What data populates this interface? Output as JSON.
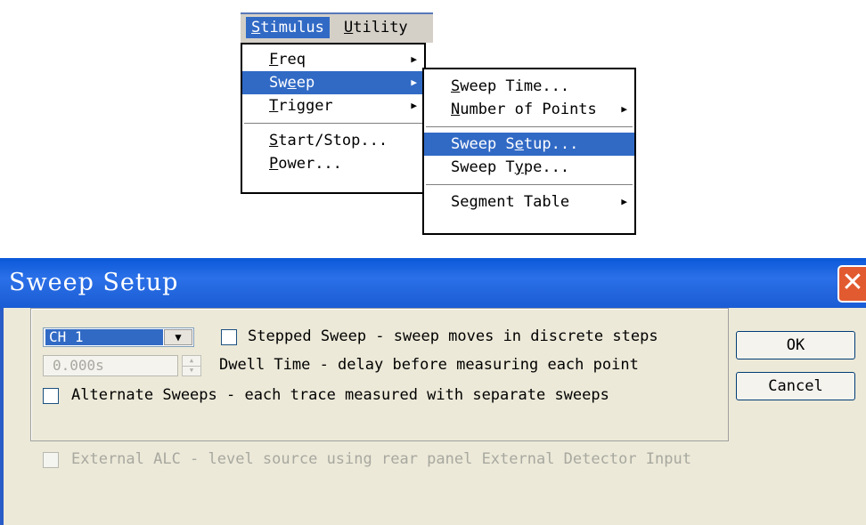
{
  "menubar": {
    "items": [
      {
        "prefix": "",
        "ul": "S",
        "rest": "timulus"
      },
      {
        "prefix": "",
        "ul": "U",
        "rest": "tility"
      }
    ]
  },
  "stimulus_menu": {
    "items": [
      {
        "prefix": "",
        "ul": "F",
        "rest": "req"
      },
      {
        "prefix": "Sw",
        "ul": "e",
        "rest": "ep"
      },
      {
        "prefix": "",
        "ul": "T",
        "rest": "rigger"
      },
      {
        "prefix": "",
        "ul": "S",
        "rest": "tart/Stop..."
      },
      {
        "prefix": "",
        "ul": "P",
        "rest": "ower..."
      }
    ]
  },
  "sweep_menu": {
    "items": [
      {
        "prefix": "",
        "ul": "S",
        "rest": "weep Time..."
      },
      {
        "prefix": "",
        "ul": "N",
        "rest": "umber of Points"
      },
      {
        "prefix": "Sweep S",
        "ul": "e",
        "rest": "tup..."
      },
      {
        "prefix": "Sweep T",
        "ul": "y",
        "rest": "pe..."
      },
      {
        "prefix": "Se",
        "ul": "g",
        "rest": "ment Table"
      }
    ]
  },
  "dialog": {
    "title": "Sweep Setup",
    "close_icon": "close-icon",
    "channel": {
      "selected": "CH 1"
    },
    "stepped_sweep": {
      "label": "Stepped Sweep - sweep moves in discrete steps",
      "checked": false
    },
    "dwell": {
      "value": "0.000s",
      "label": "Dwell Time - delay before measuring each point"
    },
    "alternate_sweeps": {
      "label": "Alternate Sweeps - each trace measured with separate sweeps",
      "checked": false
    },
    "external_alc": {
      "label": "External ALC  - level source using rear panel External Detector Input",
      "checked": false
    },
    "ok_label": "OK",
    "cancel_label": "Cancel"
  },
  "colors": {
    "highlight": "#316ac5",
    "dialog_bg": "#ece9d8",
    "titlebar": "#0a58d8",
    "close": "#e25a30"
  }
}
